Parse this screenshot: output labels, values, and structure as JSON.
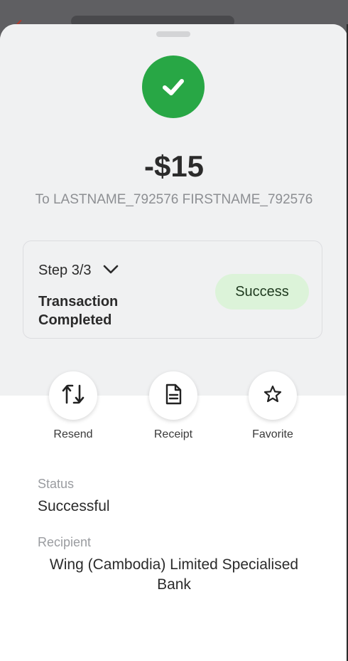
{
  "header": {
    "back_icon": "chevron-left-icon"
  },
  "result": {
    "icon": "checkmark-icon",
    "success_color": "#28a745",
    "amount": "-$15",
    "recipient_line": "To LASTNAME_792576 FIRSTNAME_792576"
  },
  "step": {
    "label": "Step 3/3",
    "status": "Transaction Completed",
    "badge": "Success"
  },
  "actions": [
    {
      "label": "Resend",
      "icon": "resend-arrows-icon"
    },
    {
      "label": "Receipt",
      "icon": "receipt-document-icon"
    },
    {
      "label": "Favorite",
      "icon": "star-icon"
    }
  ],
  "details": {
    "status_label": "Status",
    "status_value": "Successful",
    "recipient_label": "Recipient",
    "recipient_value": "Wing (Cambodia) Limited Specialised Bank"
  }
}
